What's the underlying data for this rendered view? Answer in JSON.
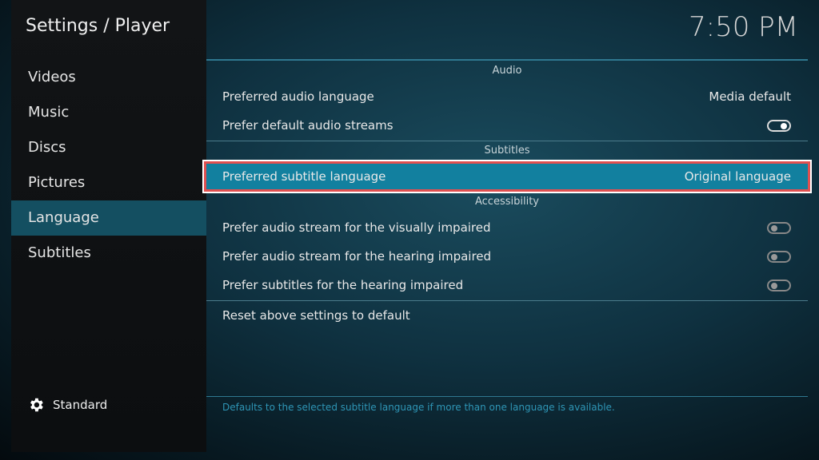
{
  "header": {
    "title": "Settings / Player",
    "clock": "7:50 PM"
  },
  "sidebar": {
    "items": [
      {
        "label": "Videos"
      },
      {
        "label": "Music"
      },
      {
        "label": "Discs"
      },
      {
        "label": "Pictures"
      },
      {
        "label": "Language",
        "selected": true
      },
      {
        "label": "Subtitles"
      }
    ],
    "level": {
      "icon": "gear-icon",
      "label": "Standard"
    }
  },
  "settings": {
    "audio_header": "Audio",
    "preferred_audio": {
      "label": "Preferred audio language",
      "value": "Media default"
    },
    "default_audio_streams": {
      "label": "Prefer default audio streams",
      "on": true
    },
    "subtitles_header": "Subtitles",
    "preferred_subtitle": {
      "label": "Preferred subtitle language",
      "value": "Original language"
    },
    "accessibility_header": "Accessibility",
    "visually_impaired": {
      "label": "Prefer audio stream for the visually impaired",
      "on": false
    },
    "hearing_impaired_audio": {
      "label": "Prefer audio stream for the hearing impaired",
      "on": false
    },
    "hearing_impaired_subs": {
      "label": "Prefer subtitles for the hearing impaired",
      "on": false
    },
    "reset": "Reset above settings to default"
  },
  "description": "Defaults to the selected subtitle language if more than one language is available.",
  "colors": {
    "accent": "#12809f",
    "highlight_border": "#e05050"
  }
}
